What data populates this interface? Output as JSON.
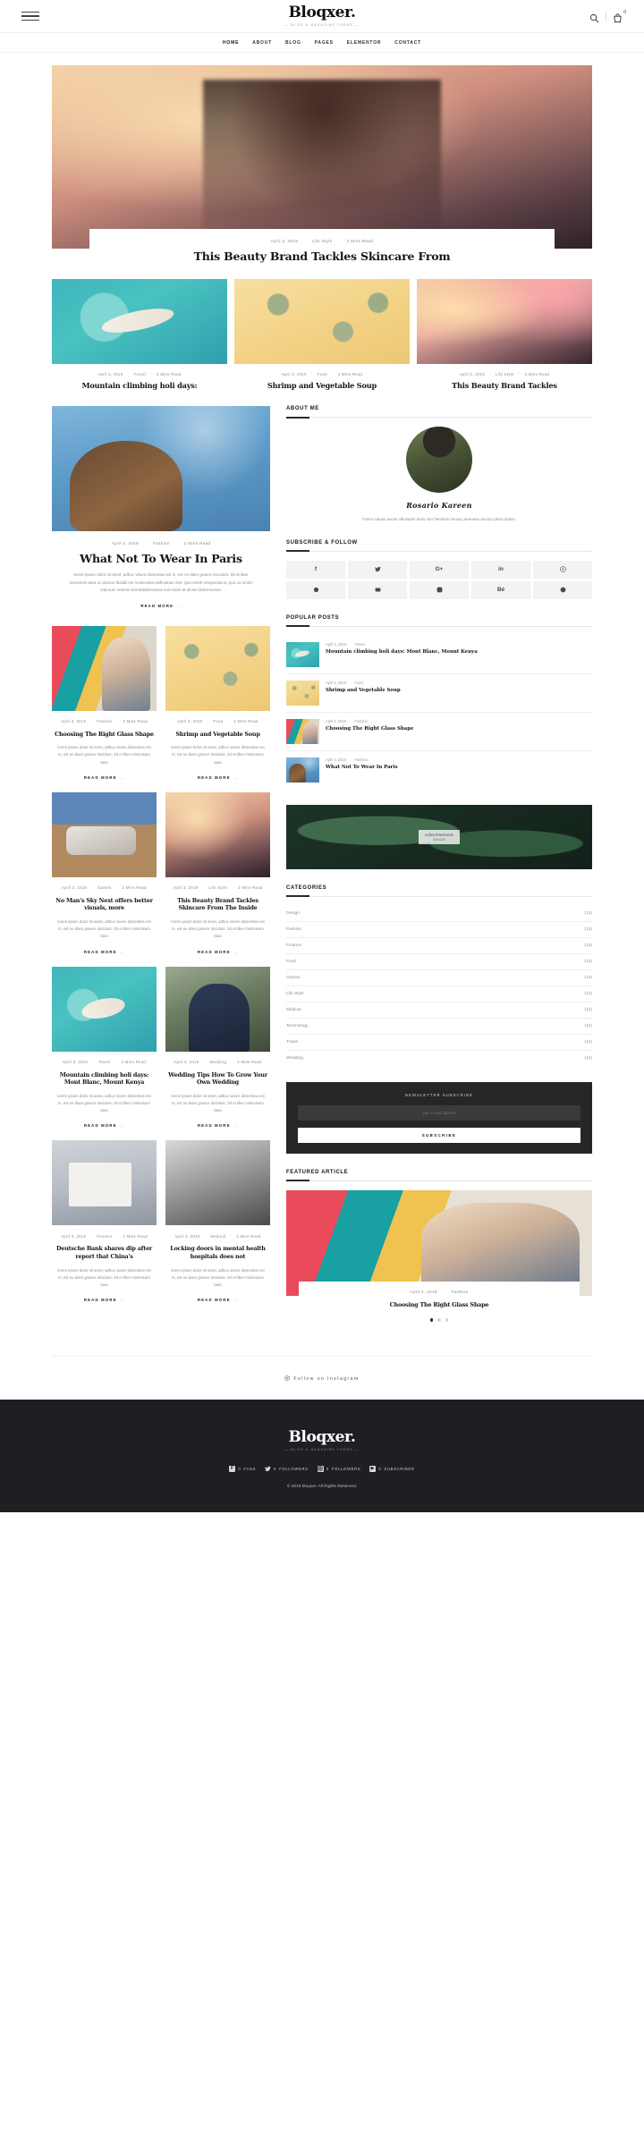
{
  "header": {
    "brand_name": "Bloqxer.",
    "brand_tagline": "BLOG & MAGAZINE THEME",
    "menu_icon": "hamburger-icon",
    "search_icon": "search-icon",
    "cart_icon": "cart-icon",
    "cart_count": "0"
  },
  "nav": {
    "items": [
      {
        "label": "HOME"
      },
      {
        "label": "ABOUT"
      },
      {
        "label": "BLOG"
      },
      {
        "label": "PAGES"
      },
      {
        "label": "ELEMENTOR"
      },
      {
        "label": "CONTACT"
      }
    ]
  },
  "hero": {
    "date": "April 3, 2019",
    "category": "Life Style",
    "read_time": "2 Mins Read",
    "title": "This Beauty Brand Tackles Skincare From"
  },
  "top_cards": [
    {
      "date": "April 3, 2019",
      "category": "Travel",
      "read_time": "2 Mins Read",
      "title": "Mountain climbing holi days:",
      "thumb": "t-pool"
    },
    {
      "date": "April 3, 2019",
      "category": "Food",
      "read_time": "2 Mins Read",
      "title": "Shrimp and Vegetable Soup",
      "thumb": "t-pine"
    },
    {
      "date": "April 3, 2019",
      "category": "Life Style",
      "read_time": "2 Mins Read",
      "title": "This Beauty Brand Tackles",
      "thumb": "t-fire"
    }
  ],
  "feature": {
    "date": "April 3, 2019",
    "category": "Fashion",
    "read_time": "2 Mins Read",
    "title": "What Not To Wear In Paris",
    "excerpt": "lorem ipsum dolor sit amet, adhuc vitues dissentias est in, est ne diam graece tincidunt. Sit et liber monstrum taea no doctus fastidii.Ne moderatius definiebas mel. Quo everti eloquentia et, quo cu omnis maiorum veteare ferentdiabonanus eum.Nam at dicant determusset.",
    "read_more": "READ MORE"
  },
  "grid_cards": [
    {
      "date": "April 3, 2019",
      "category": "Fashion",
      "read_time": "2 Mins Read",
      "title": "Choosing The Right Glass Shape",
      "excerpt": "lorem ipsum dolor sit amet, adhuc viures dissentias est in, est ne diam graece tincidunt. Sit et liber minimisum taea",
      "read_more": "READ MORE",
      "thumb": "t-girl"
    },
    {
      "date": "April 3, 2019",
      "category": "Food",
      "read_time": "2 Mins Read",
      "title": "Shrimp and Vegetable Soup",
      "excerpt": "lorem ipsum dolor sit amet, adhuc viures dissentias est in, est ne diam graece tincidunt. Sit et liber minimisum taea",
      "read_more": "READ MORE",
      "thumb": "t-pine"
    },
    {
      "date": "April 3, 2019",
      "category": "Games",
      "read_time": "2 Mins Read",
      "title": "No Man's Sky Next offers better visuals, more",
      "excerpt": "lorem ipsum dolor sit amet, adhuc viures dissentias est in, est ne diam graece tincidunt. Sit et liber minimisum taea",
      "read_more": "READ MORE",
      "thumb": "t-car"
    },
    {
      "date": "April 3, 2019",
      "category": "Life Style",
      "read_time": "2 Mins Read",
      "title": "This Beauty Brand Tackles Skincare From The Inside",
      "excerpt": "lorem ipsum dolor sit amet, adhuc viures dissentias est in, est ne diam graece tincidunt. Sit et liber minimisum taea",
      "read_more": "READ MORE",
      "thumb": "t-dance"
    },
    {
      "date": "April 3, 2019",
      "category": "Travel",
      "read_time": "2 Mins Read",
      "title": "Mountain climbing holi days: Mont Blanc, Mount Kenya",
      "excerpt": "lorem ipsum dolor sit amet, adhuc viures dissentias est in, est ne diam graece tincidunt. Sit et liber minimisum taea",
      "read_more": "READ MORE",
      "thumb": "t-pool"
    },
    {
      "date": "April 3, 2019",
      "category": "Wedding",
      "read_time": "2 Mins Read",
      "title": "Wedding Tips How To Grow Your Own Wedding",
      "excerpt": "lorem ipsum dolor sit amet, adhuc viures dissentias est in, est ne diam graece tincidunt. Sit et liber minimisum taea",
      "read_more": "READ MORE",
      "thumb": "t-wed"
    },
    {
      "date": "April 3, 2019",
      "category": "Finance",
      "read_time": "2 Mins Read",
      "title": "Deutsche Bank shares dip after report that China's",
      "excerpt": "lorem ipsum dolor sit amet, adhuc viures dissentias est in, est ne diam graece tincidunt. Sit et liber minimisum taea",
      "read_more": "READ MORE",
      "thumb": "t-bank"
    },
    {
      "date": "April 4, 2019",
      "category": "Medical",
      "read_time": "2 Mins Read",
      "title": "Locking doors in mental health hospitals does not",
      "excerpt": "lorem ipsum dolor sit amet, adhuc viures dissentias est in, est ne diam graece tincidunt. Sit et liber minimisum taea",
      "read_more": "READ MORE",
      "thumb": "t-bw"
    }
  ],
  "sidebar": {
    "about": {
      "heading": "ABOUT ME",
      "author_name": "Rosario Kareen",
      "bio": "Fusce mauris auctor ollicituder teary iner hendrerit risusey aeenean rauctor pibus doloer."
    },
    "subscribe": {
      "heading": "SUBSCRIBE & FOLLOW",
      "socials": [
        {
          "name": "facebook-icon",
          "glyph": "f"
        },
        {
          "name": "twitter-icon",
          "glyph": "t"
        },
        {
          "name": "google-plus-icon",
          "glyph": "G+"
        },
        {
          "name": "linkedin-icon",
          "glyph": "in"
        },
        {
          "name": "pinterest-icon",
          "glyph": "P"
        },
        {
          "name": "skype-icon",
          "glyph": "S"
        },
        {
          "name": "youtube-icon",
          "glyph": "Y"
        },
        {
          "name": "instagram-icon",
          "glyph": "I"
        },
        {
          "name": "behance-icon",
          "glyph": "Bé"
        },
        {
          "name": "dribbble-icon",
          "glyph": "D"
        }
      ]
    },
    "popular": {
      "heading": "POPULAR POSTS",
      "items": [
        {
          "date": "April 3, 2019",
          "category": "Travel",
          "title": "Mountain climbing holi days: Mont Blanc, Mount Kenya",
          "thumb": "t-pool"
        },
        {
          "date": "April 3, 2019",
          "category": "Food",
          "title": "Shrimp and Vegetable Soup",
          "thumb": "t-pine"
        },
        {
          "date": "April 2, 2019",
          "category": "Fashion",
          "title": "Choosing The Right Glass Shape",
          "thumb": "t-girl"
        },
        {
          "date": "April 3, 2019",
          "category": "Fashion",
          "title": "What Not To Wear In Paris",
          "thumb": "t-sea"
        }
      ]
    },
    "promo": {
      "line1": "Advertisement",
      "line2": "300x240"
    },
    "categories": {
      "heading": "CATEGORIES",
      "items": [
        {
          "label": "Design",
          "count": "(12)"
        },
        {
          "label": "Fashion",
          "count": "(12)"
        },
        {
          "label": "Finance",
          "count": "(12)"
        },
        {
          "label": "Food",
          "count": "(12)"
        },
        {
          "label": "Games",
          "count": "(12)"
        },
        {
          "label": "Life Style",
          "count": "(12)"
        },
        {
          "label": "Medical",
          "count": "(12)"
        },
        {
          "label": "Technology",
          "count": "(12)"
        },
        {
          "label": "Travel",
          "count": "(12)"
        },
        {
          "label": "Wedding",
          "count": "(12)"
        }
      ]
    },
    "newsletter": {
      "heading": "NEWSLETTER SUBSCRIBE",
      "placeholder": "your e-mail address",
      "button": "SUBSCRIBE"
    },
    "featured": {
      "heading": "FEATURED ARTICLE",
      "date": "April 2, 2019",
      "category": "Fashion",
      "title": "Choosing The Right Glass Shape"
    }
  },
  "instagram": {
    "label": "Follow on Instagram"
  },
  "footer": {
    "brand_name": "Bloqxer.",
    "brand_tagline": "BLOG & MAGAZINE THEME",
    "stats": [
      {
        "icon": "facebook-icon",
        "glyph": "f",
        "count": "0",
        "label": "FANS"
      },
      {
        "icon": "twitter-icon",
        "glyph": "t",
        "count": "0",
        "label": "FOLLOWERS"
      },
      {
        "icon": "instagram-icon",
        "glyph": "I",
        "count": "0",
        "label": "FOLLOWERS"
      },
      {
        "icon": "youtube-icon",
        "glyph": "Y",
        "count": "0",
        "label": "SUBSCRIBER"
      }
    ],
    "copyright": "© 2019 bloqxer. All Rights Reserved."
  }
}
